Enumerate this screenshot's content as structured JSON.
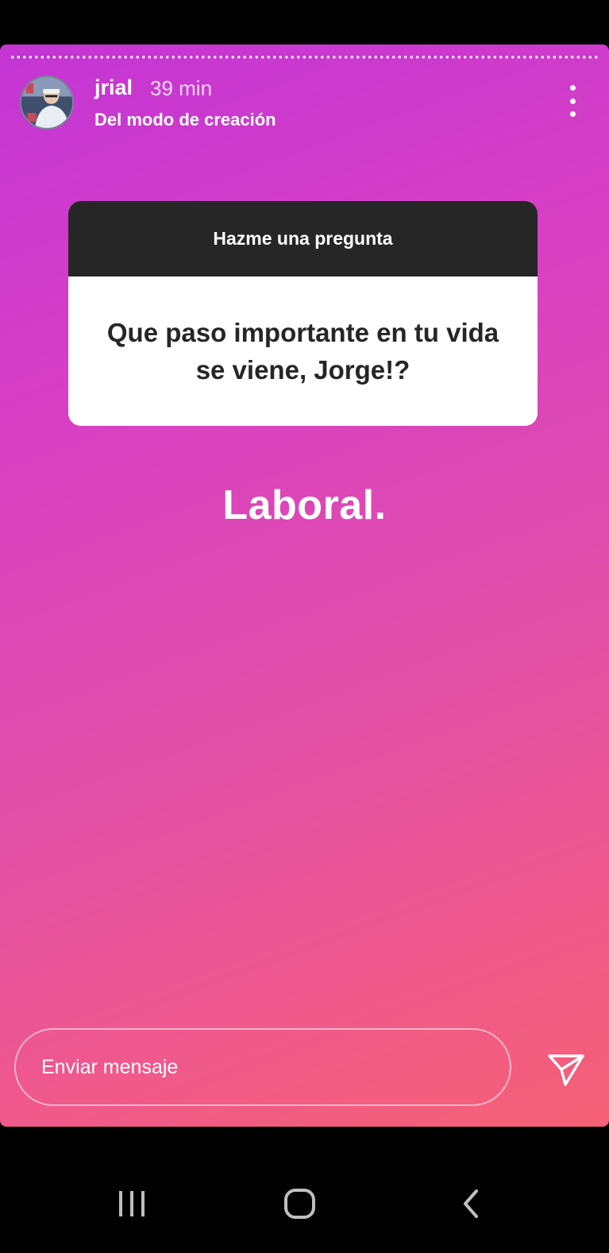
{
  "story": {
    "username": "jrial",
    "time_ago": "39 min",
    "subtitle": "Del modo de creación",
    "menu_icon": "more-vertical-icon"
  },
  "question_sticker": {
    "header": "Hazme una pregunta",
    "question": "Que paso importante en tu vida se viene, Jorge!?"
  },
  "answer_text": "Laboral.",
  "reply_bar": {
    "placeholder": "Enviar mensaje",
    "send_icon": "send-paper-plane-icon"
  },
  "navigation_bar": {
    "recents_icon": "recent-apps-icon",
    "home_icon": "home-icon",
    "back_icon": "back-chevron-icon"
  },
  "colors": {
    "gradient_start": "#c335d4",
    "gradient_end": "#f56176",
    "sticker_header": "#262626"
  }
}
